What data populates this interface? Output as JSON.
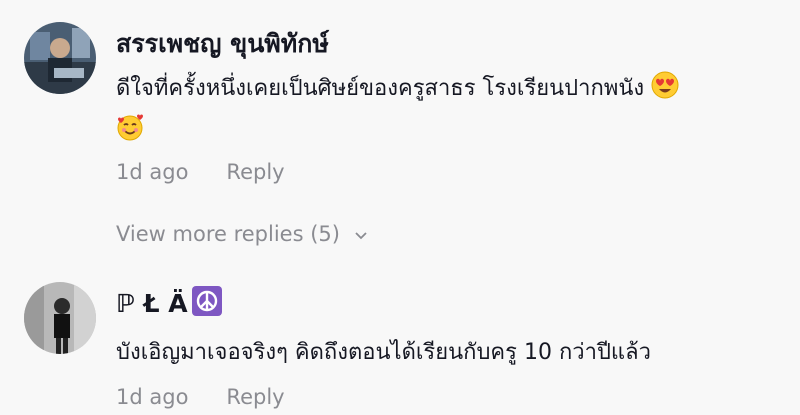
{
  "comments": [
    {
      "username": "สรรเพชญ ขุนพิทักษ์",
      "text": "ดีใจที่ครั้งหนึ่งเคยเป็นศิษย์ของครูสาธร โรงเรียนปากพนัง",
      "emojis": [
        "heart-eyes-emoji",
        "smiling-face-with-hearts-emoji"
      ],
      "time": "1d ago",
      "reply_label": "Reply",
      "view_more": "View more replies (5)"
    },
    {
      "username": "ℙ Ł Ä",
      "username_badge": "peace-symbol-emoji",
      "text": "บังเอิญมาเจอจริงๆ คิดถึงตอนได้เรียนกับครู 10 กว่าปีแล้ว",
      "time": "1d ago",
      "reply_label": "Reply"
    }
  ],
  "colors": {
    "background": "#f8f8f8",
    "text": "#161823",
    "secondary": "#8a8b91",
    "peace_badge": "#7e57c2"
  }
}
